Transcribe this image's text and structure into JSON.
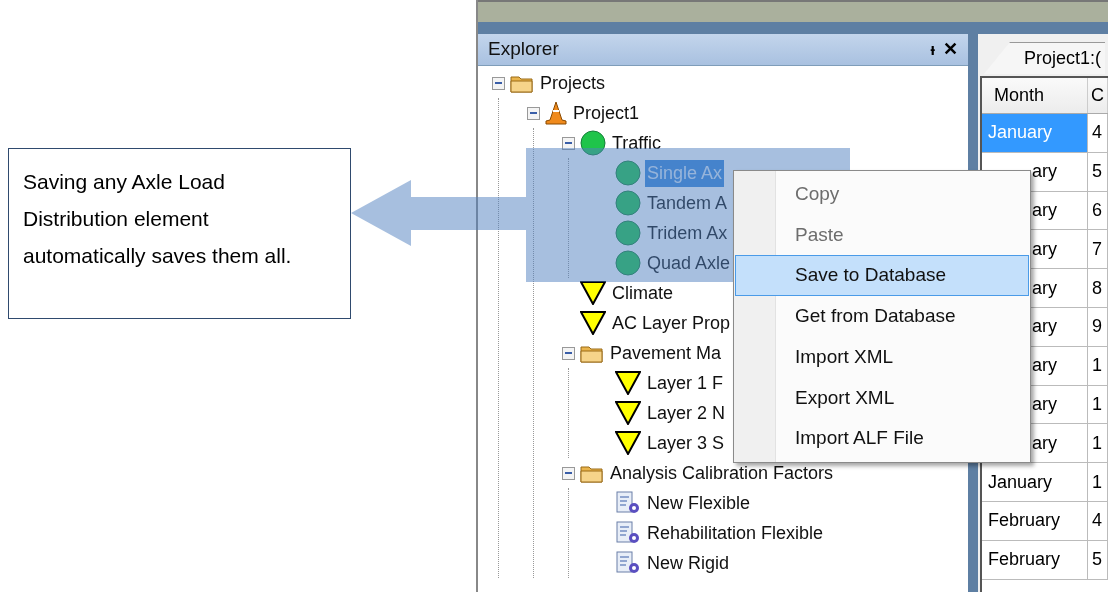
{
  "callout": {
    "text": "Saving any Axle Load Distribution element automatically saves them all."
  },
  "explorer": {
    "title": "Explorer",
    "pin": "ᵼ",
    "close": "✕",
    "tree": [
      {
        "label": "Projects",
        "kind": "folder",
        "expanded": true,
        "selected": false,
        "children": [
          {
            "label": "Project1",
            "kind": "cone",
            "expanded": true,
            "selected": false,
            "children": [
              {
                "label": "Traffic",
                "kind": "circle",
                "expanded": true,
                "selected": false,
                "children": [
                  {
                    "label": "Single Ax",
                    "kind": "circle",
                    "selected": true
                  },
                  {
                    "label": "Tandem A",
                    "kind": "circle",
                    "selected": false
                  },
                  {
                    "label": "Tridem Ax",
                    "kind": "circle",
                    "selected": false
                  },
                  {
                    "label": "Quad Axle",
                    "kind": "circle",
                    "selected": false
                  }
                ]
              },
              {
                "label": "Climate",
                "kind": "triangle",
                "selected": false
              },
              {
                "label": "AC Layer Prop",
                "kind": "triangle",
                "selected": false
              },
              {
                "label": "Pavement Ma",
                "kind": "folder",
                "expanded": true,
                "selected": false,
                "children": [
                  {
                    "label": "Layer 1 F",
                    "kind": "triangle",
                    "selected": false
                  },
                  {
                    "label": "Layer 2 N",
                    "kind": "triangle",
                    "selected": false
                  },
                  {
                    "label": "Layer 3 S",
                    "kind": "triangle",
                    "selected": false
                  }
                ]
              },
              {
                "label": "Analysis Calibration Factors",
                "kind": "folder",
                "expanded": true,
                "selected": false,
                "children": [
                  {
                    "label": "New Flexible",
                    "kind": "doc",
                    "selected": false
                  },
                  {
                    "label": "Rehabilitation Flexible",
                    "kind": "doc",
                    "selected": false
                  },
                  {
                    "label": "New Rigid",
                    "kind": "doc",
                    "selected": false
                  }
                ]
              }
            ]
          }
        ]
      }
    ]
  },
  "document": {
    "tab": "Project1:(",
    "columns": [
      "Month",
      "C"
    ],
    "rows": [
      {
        "cells": [
          "January",
          "4"
        ],
        "selected": true,
        "covered": false
      },
      {
        "cells": [
          "ary",
          "5"
        ],
        "selected": false,
        "covered": true
      },
      {
        "cells": [
          "ary",
          "6"
        ],
        "selected": false,
        "covered": true
      },
      {
        "cells": [
          "ary",
          "7"
        ],
        "selected": false,
        "covered": true
      },
      {
        "cells": [
          "ary",
          "8"
        ],
        "selected": false,
        "covered": true
      },
      {
        "cells": [
          "ary",
          "9"
        ],
        "selected": false,
        "covered": true
      },
      {
        "cells": [
          "ary",
          "1"
        ],
        "selected": false,
        "covered": true
      },
      {
        "cells": [
          "ary",
          "1"
        ],
        "selected": false,
        "covered": true
      },
      {
        "cells": [
          "ary",
          "1"
        ],
        "selected": false,
        "covered": true
      },
      {
        "cells": [
          "January",
          "1"
        ],
        "selected": false,
        "covered": false
      },
      {
        "cells": [
          "February",
          "4"
        ],
        "selected": false,
        "covered": false
      },
      {
        "cells": [
          "February",
          "5"
        ],
        "selected": false,
        "covered": false
      }
    ]
  },
  "context_menu": [
    {
      "label": "Copy",
      "disabled": true,
      "selected": false
    },
    {
      "label": "Paste",
      "disabled": true,
      "selected": false
    },
    {
      "label": "Save to Database",
      "disabled": false,
      "selected": true
    },
    {
      "label": "Get from Database",
      "disabled": false,
      "selected": false
    },
    {
      "label": "Import XML",
      "disabled": false,
      "selected": false
    },
    {
      "label": "Export XML",
      "disabled": false,
      "selected": false
    },
    {
      "label": "Import ALF File",
      "disabled": false,
      "selected": false
    }
  ]
}
